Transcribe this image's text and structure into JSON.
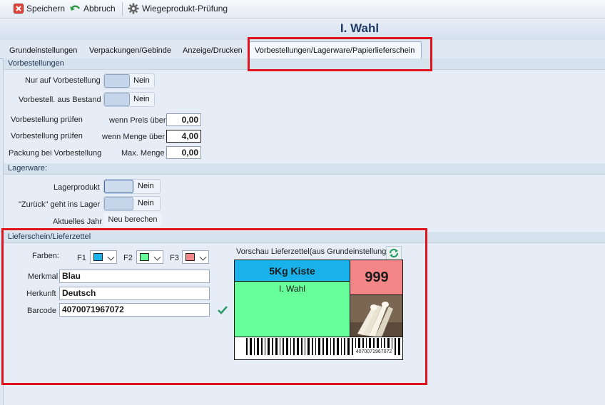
{
  "toolbar": {
    "save_label": "Speichern",
    "cancel_label": "Abbruch",
    "weigh_check_label": "Wiegeprodukt-Prüfung"
  },
  "header": {
    "title": "I. Wahl"
  },
  "tabs": [
    {
      "label": "Grundeinstellungen"
    },
    {
      "label": "Verpackungen/Gebinde"
    },
    {
      "label": "Anzeige/Drucken"
    },
    {
      "label": "Vorbestellungen/Lagerware/Papierlieferschein",
      "active": true
    }
  ],
  "preorders": {
    "section_title": "Vorbestellungen",
    "only_preorder_label": "Nur auf Vorbestellung",
    "only_preorder_value": "Nein",
    "from_stock_label": "Vorbestell. aus Bestand",
    "from_stock_value": "Nein",
    "check_price_label": "Vorbestellung prüfen",
    "check_price_cond": "wenn Preis über",
    "check_price_value": "0,00",
    "check_qty_label": "Vorbestellung prüfen",
    "check_qty_cond": "wenn Menge über",
    "check_qty_value": "4,00",
    "package_label": "Packung bei Vorbestellung",
    "package_cond": "Max. Menge",
    "package_value": "0,00"
  },
  "stock": {
    "section_title": "Lagerware:",
    "stock_product_label": "Lagerprodukt",
    "stock_product_value": "Nein",
    "return_label": "\"Zurück\" geht ins Lager",
    "return_value": "Nein",
    "year_label": "Aktuelles Jahr",
    "recalc_button": "Neu berechen"
  },
  "delivery": {
    "section_title": "Lieferschein/Lieferzettel",
    "colors_label": "Farben:",
    "f1_label": "F1",
    "f1_color": "#1ab2ea",
    "f2_label": "F2",
    "f2_color": "#66ff99",
    "f3_label": "F3",
    "f3_color": "#f58687",
    "feature_label": "Merkmal",
    "feature_value": "Blau",
    "origin_label": "Herkunft",
    "origin_value": "Deutsch",
    "barcode_label": "Barcode",
    "barcode_value": "4070071967072",
    "preview_label": "Vorschau Lieferzettel(aus Grundeinstellung)"
  },
  "preview_card": {
    "package": "5Kg Kiste",
    "number": "999",
    "quality": "I. Wahl",
    "barcode_text": "4070071967072",
    "product_image": "white-asparagus-image"
  },
  "colors": {
    "highlight_red": "#e0121b",
    "title_blue": "#1e3a64",
    "card_blue": "#1ab2ea",
    "card_green": "#66ff99",
    "card_red": "#f58687"
  }
}
